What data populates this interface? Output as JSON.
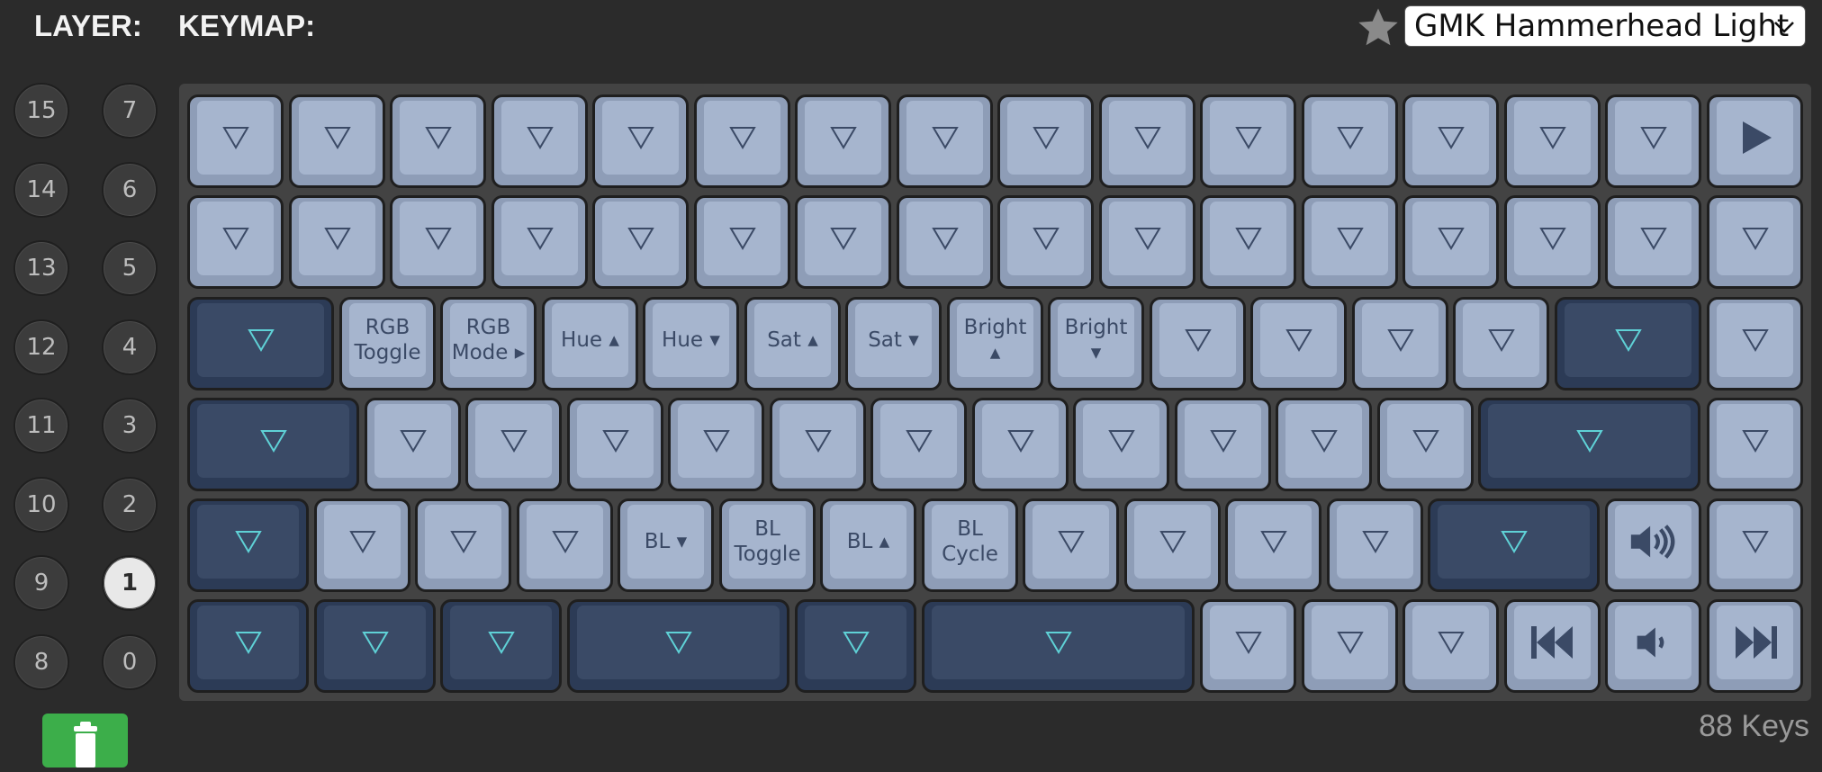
{
  "header": {
    "layer_label": "LAYER:",
    "keymap_label": "KEYMAP:",
    "favorite_icon": "star-icon",
    "theme_select": "GMK Hammerhead Light"
  },
  "layers": {
    "left_column": [
      "15",
      "14",
      "13",
      "12",
      "11",
      "10",
      "9",
      "8"
    ],
    "right_column": [
      "7",
      "6",
      "5",
      "4",
      "3",
      "2",
      "1",
      "0"
    ],
    "active": "1"
  },
  "keyboard": {
    "colors": {
      "light_cap": "#a6b5ce",
      "dark_cap": "#3a4a66",
      "legend_dark": "#3b4a66",
      "legend_accent": "#5fd1d6"
    },
    "legends": {
      "rgb_toggle": "RGB\nToggle",
      "rgb_mode": "RGB\nMode ▸",
      "hue_up": "Hue ▴",
      "hue_down": "Hue ▾",
      "sat_up": "Sat ▴",
      "sat_down": "Sat ▾",
      "bright_up": "Bright\n▴",
      "bright_down": "Bright\n▾",
      "bl_down": "BL ▾",
      "bl_toggle": "BL\nToggle",
      "bl_up": "BL ▴",
      "bl_cycle": "BL\nCycle"
    },
    "icons": {
      "transparent": "transparent-key-icon",
      "play": "play-icon",
      "volume_up": "volume-up-icon",
      "volume_down": "volume-down-icon",
      "prev_track": "previous-track-icon",
      "next_track": "next-track-icon"
    }
  },
  "footer": {
    "delete_icon": "trash-icon",
    "keys_count": "88 Keys"
  }
}
